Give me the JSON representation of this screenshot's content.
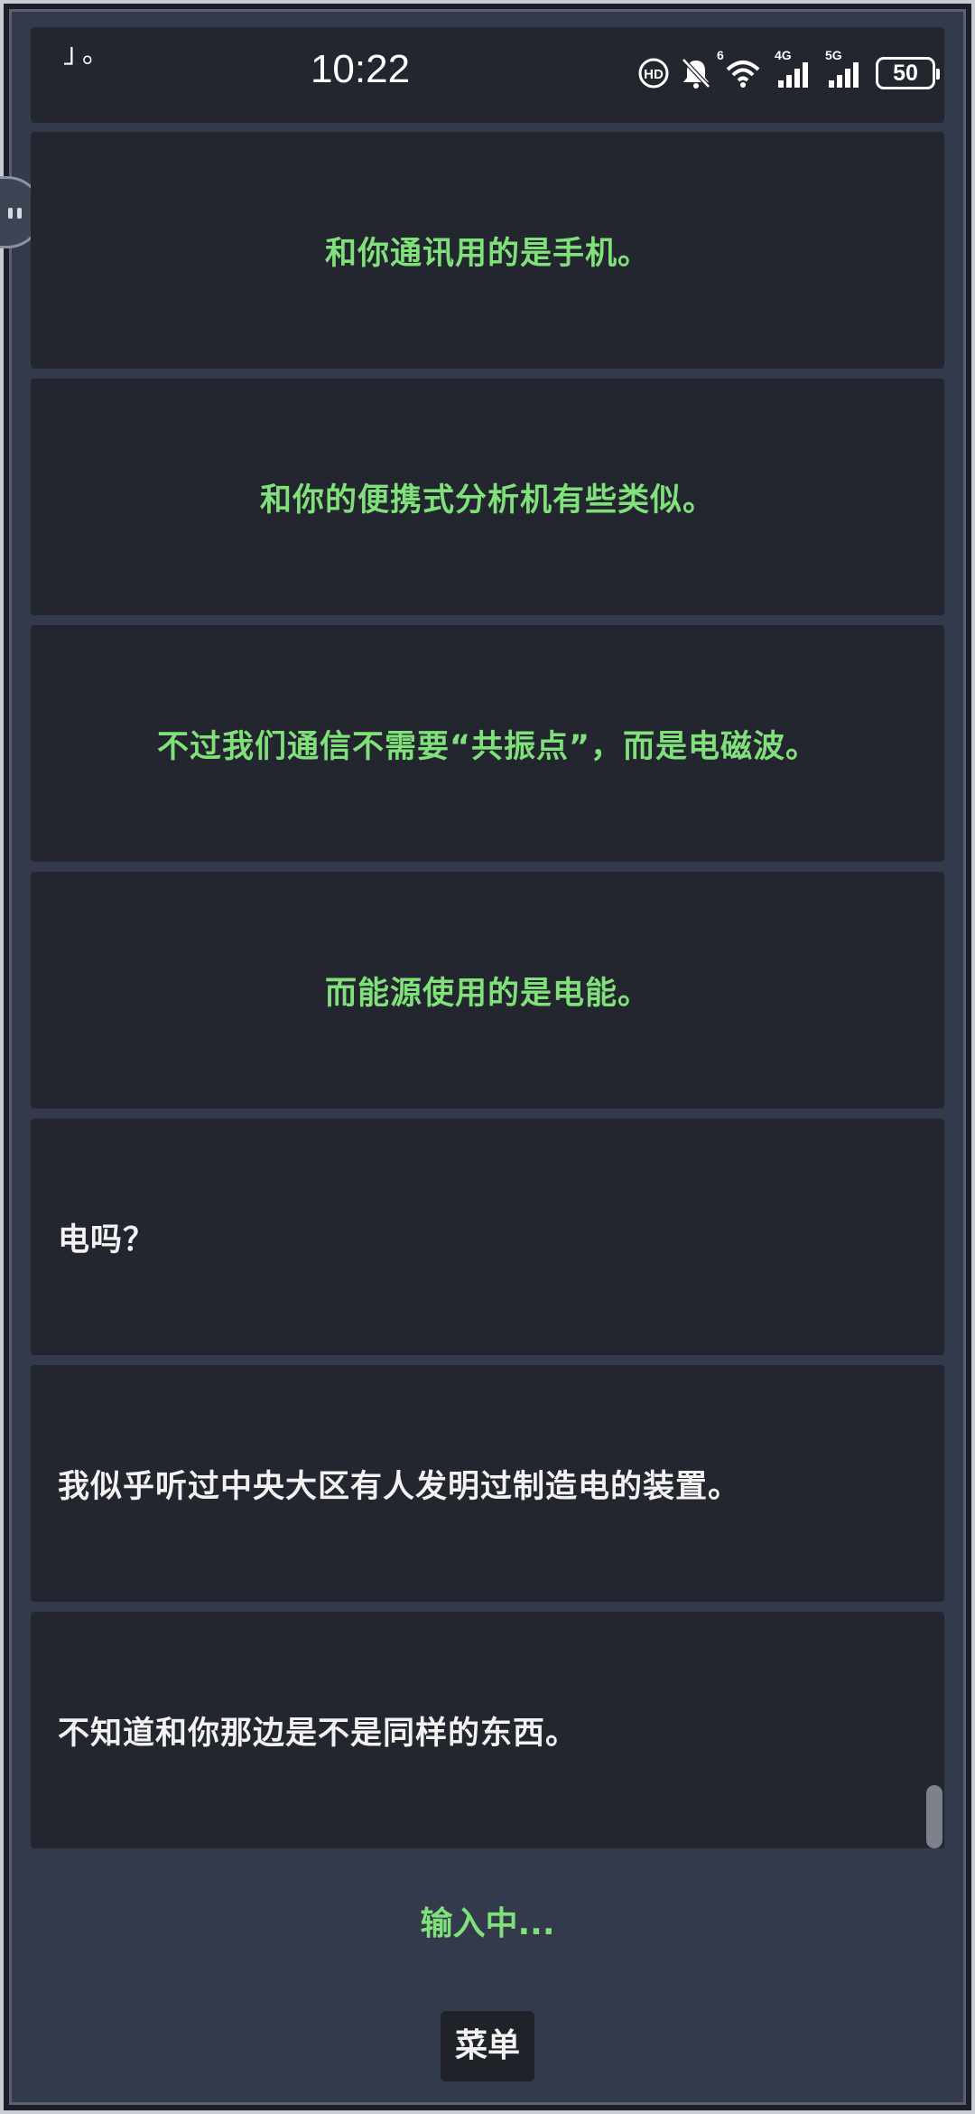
{
  "status_bar": {
    "note_text": "」。",
    "time": "10:22",
    "icons": [
      "hd-call-icon",
      "mute-bell-icon",
      "wifi-6-icon",
      "signal-4g-icon",
      "signal-5g-icon"
    ],
    "wifi_tag": "6",
    "net1_tag": "4G",
    "net2_tag": "5G",
    "battery": "50"
  },
  "dialog": [
    {
      "text": "和你通讯用的是手机。",
      "align": "center",
      "speaker": "green"
    },
    {
      "text": "和你的便携式分析机有些类似。",
      "align": "center",
      "speaker": "green"
    },
    {
      "text": "不过我们通信不需要“共振点”，而是电磁波。",
      "align": "center",
      "speaker": "green"
    },
    {
      "text": "而能源使用的是电能。",
      "align": "center",
      "speaker": "green"
    },
    {
      "text": "电吗？",
      "align": "left",
      "speaker": "white"
    },
    {
      "text": "我似乎听过中央大区有人发明过制造电的装置。",
      "align": "left",
      "speaker": "white"
    },
    {
      "text": "不知道和你那边是不是同样的东西。",
      "align": "left",
      "speaker": "white"
    }
  ],
  "typing_indicator": "输入中...",
  "menu_label": "菜单",
  "colors": {
    "background": "#333a4b",
    "dialog_box": "#23262e",
    "green_text": "#80e07a",
    "white_text": "#f2f2f2"
  }
}
